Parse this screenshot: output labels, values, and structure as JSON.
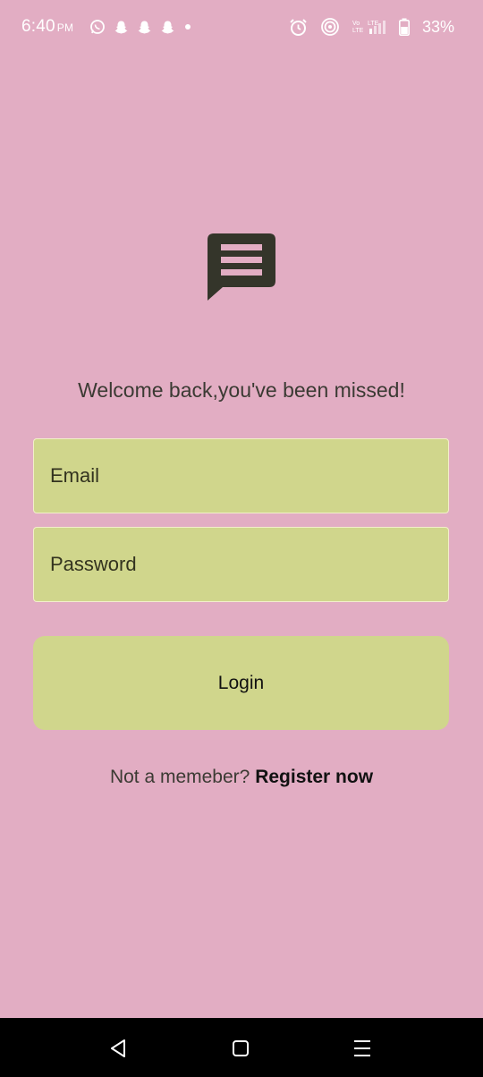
{
  "status_bar": {
    "time": "6:40",
    "ampm": "PM",
    "battery": "33%",
    "left_icons": [
      "whatsapp-icon",
      "snapchat-icon",
      "snapchat-icon",
      "snapchat-icon",
      "dot-icon"
    ],
    "right_icons": [
      "alarm-icon",
      "hotspot-icon",
      "volte-lte-icon",
      "signal-icon",
      "battery-icon"
    ],
    "volte_text": "Vo LTE",
    "lte_text": "LTE"
  },
  "logo": {
    "icon": "message-icon",
    "color": "#34352a"
  },
  "welcome_text": "Welcome back,you've been missed!",
  "form": {
    "email_placeholder": "Email",
    "password_placeholder": "Password",
    "login_label": "Login"
  },
  "register": {
    "prompt": "Not a memeber?",
    "link_label": "Register now"
  },
  "nav": {
    "back_icon": "back-triangle-icon",
    "home_icon": "home-square-icon",
    "recents_icon": "menu-lines-icon"
  },
  "colors": {
    "background": "#e2adc3",
    "field": "#d0d68c",
    "text": "#3b3a33",
    "nav_bar": "#000000"
  }
}
